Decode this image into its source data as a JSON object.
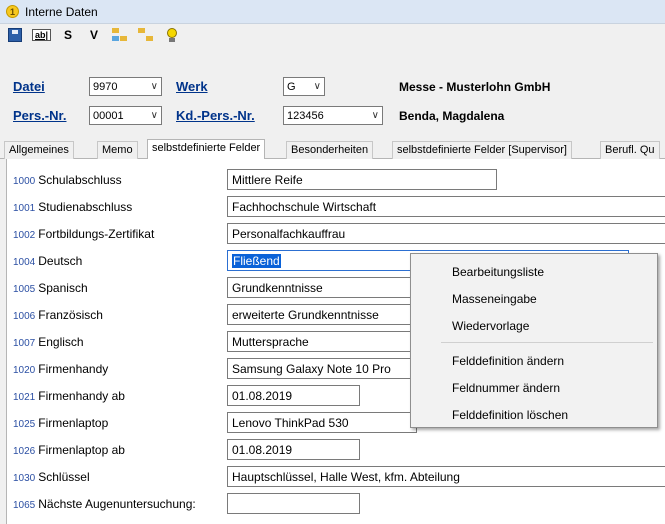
{
  "window": {
    "title": "Interne Daten",
    "badge": "1"
  },
  "toolbar": {
    "s_label": "S",
    "v_label": "V"
  },
  "header": {
    "datei_label": "Datei",
    "datei_value": "9970",
    "werk_label": "Werk",
    "werk_value": "G",
    "company": "Messe - Musterlohn GmbH",
    "persnr_label": "Pers.-Nr.",
    "persnr_value": "00001",
    "kdpers_label": "Kd.-Pers.-Nr.",
    "kdpers_value": "123456",
    "employee": "Benda, Magdalena"
  },
  "tabs": [
    {
      "label": "Allgemeines"
    },
    {
      "label": "Memo"
    },
    {
      "label": "selbstdefinierte Felder"
    },
    {
      "label": "Besonderheiten"
    },
    {
      "label": "selbstdefinierte Felder [Supervisor]"
    },
    {
      "label": "Berufl. Qu"
    }
  ],
  "fields": [
    {
      "num": "1000",
      "label": "Schulabschluss",
      "value": "Mittlere Reife"
    },
    {
      "num": "1001",
      "label": "Studienabschluss",
      "value": "Fachhochschule Wirtschaft"
    },
    {
      "num": "1002",
      "label": "Fortbildungs-Zertifikat",
      "value": "Personalfachkauffrau"
    },
    {
      "num": "1004",
      "label": "Deutsch",
      "value": "Fließend"
    },
    {
      "num": "1005",
      "label": "Spanisch",
      "value": "Grundkenntnisse"
    },
    {
      "num": "1006",
      "label": "Französisch",
      "value": "erweiterte Grundkenntnisse"
    },
    {
      "num": "1007",
      "label": "Englisch",
      "value": "Muttersprache"
    },
    {
      "num": "1020",
      "label": "Firmenhandy",
      "value": "Samsung Galaxy Note 10 Pro"
    },
    {
      "num": "1021",
      "label": "Firmenhandy ab",
      "value": "01.08.2019"
    },
    {
      "num": "1025",
      "label": "Firmenlaptop",
      "value": "Lenovo ThinkPad 530"
    },
    {
      "num": "1026",
      "label": "Firmenlaptop ab",
      "value": "01.08.2019"
    },
    {
      "num": "1030",
      "label": "Schlüssel",
      "value": "Hauptschlüssel, Halle West, kfm. Abteilung"
    },
    {
      "num": "1065",
      "label": "Nächste Augenuntersuchung:",
      "value": ""
    }
  ],
  "context_menu": {
    "items": [
      "Bearbeitungsliste",
      "Masseneingabe",
      "Wiedervorlage",
      "Felddefinition ändern",
      "Feldnummer ändern",
      "Felddefinition löschen"
    ]
  }
}
